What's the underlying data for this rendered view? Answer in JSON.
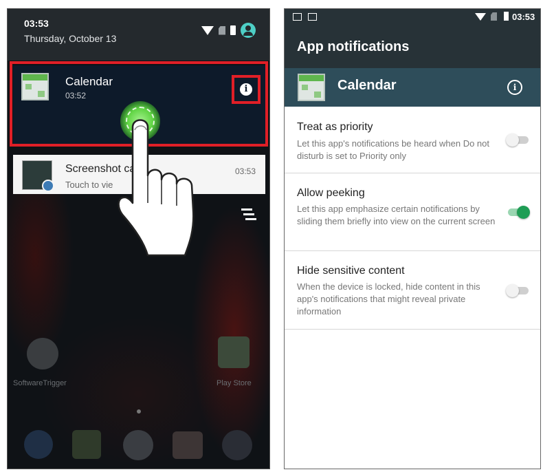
{
  "left": {
    "status": {
      "time": "03:53",
      "date": "Thursday, October 13"
    },
    "calendar_notification": {
      "app": "Calendar",
      "time": "03:52"
    },
    "screenshot_notification": {
      "title": "Screenshot ca",
      "body": "Touch to vie",
      "time": "03:53"
    },
    "home_apps": [
      {
        "label": "SoftwareTrigger"
      },
      {
        "label": "Play Store"
      }
    ]
  },
  "right": {
    "status": {
      "time": "03:53"
    },
    "title": "App notifications",
    "app_name": "Calendar",
    "settings": [
      {
        "title": "Treat as priority",
        "desc": "Let this app's notifications be heard when Do not disturb is set to Priority only",
        "enabled": false
      },
      {
        "title": "Allow peeking",
        "desc": "Let this app emphasize certain notifications by sliding them briefly into view on the current screen",
        "enabled": true
      },
      {
        "title": "Hide sensitive content",
        "desc": "When the device is locked, hide content in this app's notifications that might reveal private information",
        "enabled": false
      }
    ]
  },
  "colors": {
    "highlight": "#e01f27",
    "toggle_on": "#1f9d55",
    "app_header": "#2e4d5a",
    "tap_glow": "#5fd443"
  }
}
